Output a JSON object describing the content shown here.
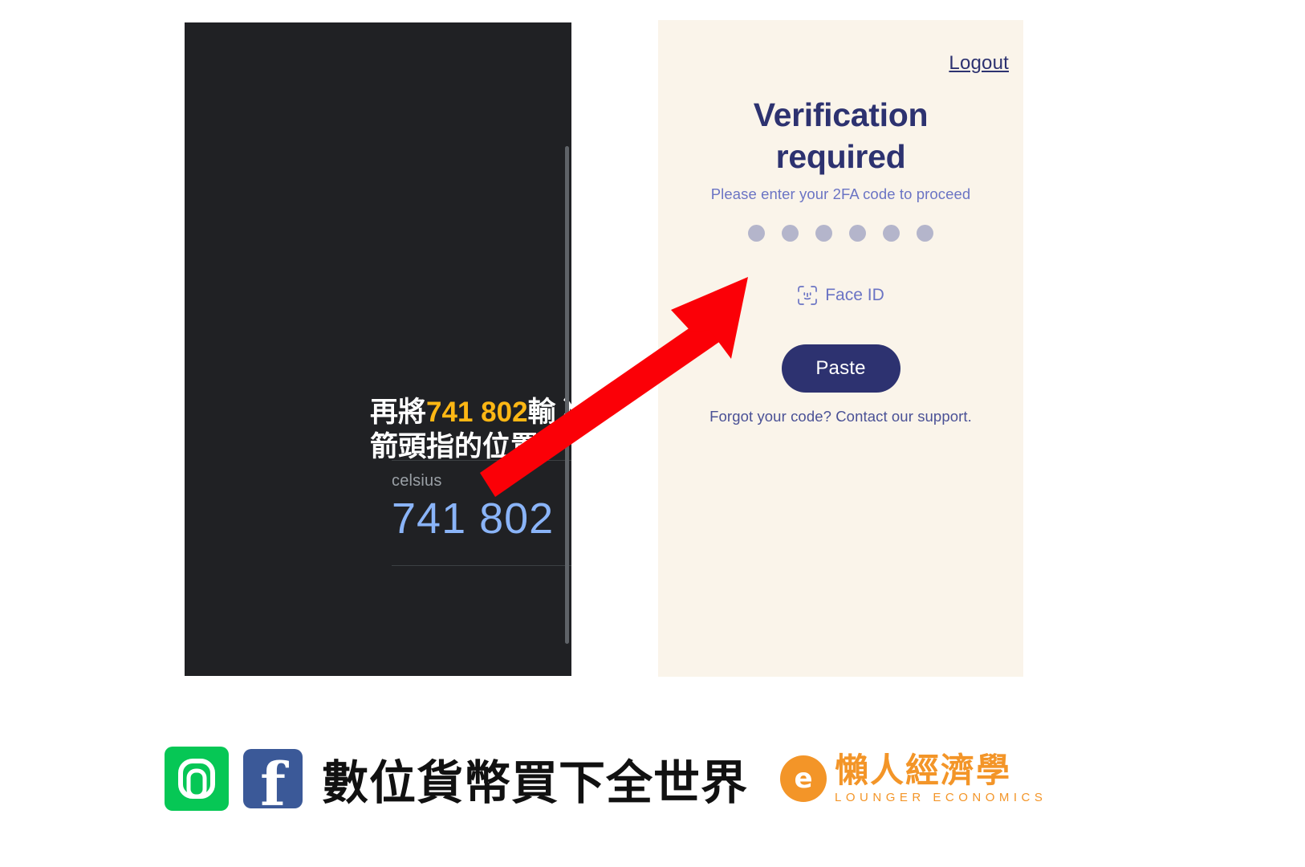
{
  "authenticator": {
    "annotation": {
      "prefix": "再將",
      "code_highlight": "741 802",
      "suffix": "輸入進",
      "line2": "箭頭指的位置"
    },
    "account_name": "celsius",
    "code": "741 802",
    "timer_icon": "countdown-pie-icon",
    "fab_icon": "add-plus-icon",
    "scrollbar": "vertical-scrollbar"
  },
  "verification": {
    "logout_label": "Logout",
    "title_line1": "Verification",
    "title_line2": "required",
    "subtitle": "Please enter your 2FA code to proceed",
    "code_dots": 6,
    "faceid_label": "Face ID",
    "faceid_icon": "face-id-icon",
    "paste_label": "Paste",
    "support_text": "Forgot your code? Contact our support.",
    "accent_color": "#2d3270",
    "background_color": "#faf4ea"
  },
  "annotation_arrow": {
    "name": "red-arrow",
    "color": "#fb0007"
  },
  "footer": {
    "line_icon": "line-app-icon",
    "facebook_icon": "facebook-icon",
    "facebook_glyph": "f",
    "brand_title": "數位貨幣買下全世界",
    "lounger_mark": "lounger-logo-icon",
    "lounger_mark_glyph": "e",
    "lounger_cn": "懶人經濟學",
    "lounger_en": "LOUNGER ECONOMICS",
    "brand_color": "#f39528"
  }
}
